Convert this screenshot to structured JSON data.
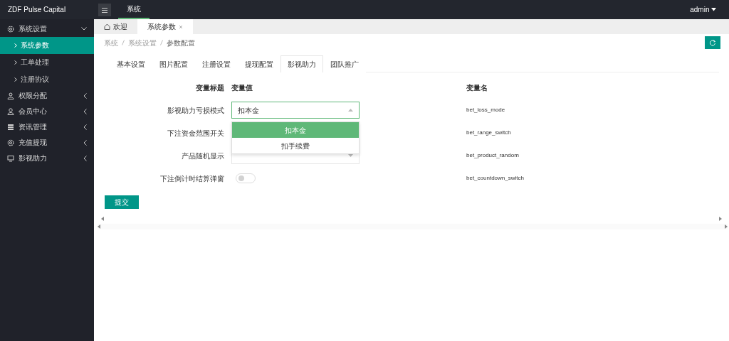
{
  "app": {
    "title": "ZDF Pulse Capital"
  },
  "top_nav": [
    {
      "label": "系统",
      "selected": true
    }
  ],
  "user_menu": {
    "label": "admin"
  },
  "sidebar": {
    "items": [
      {
        "label": "系统设置",
        "expanded": true,
        "children": [
          {
            "label": "系统参数",
            "selected": true
          },
          {
            "label": "工单处理",
            "selected": false
          },
          {
            "label": "注册协议",
            "selected": false
          }
        ]
      },
      {
        "label": "权限分配",
        "expanded": false
      },
      {
        "label": "会员中心",
        "expanded": false
      },
      {
        "label": "资讯管理",
        "expanded": false
      },
      {
        "label": "充值提现",
        "expanded": false
      },
      {
        "label": "影视助力",
        "expanded": false
      }
    ]
  },
  "page_tabs": [
    {
      "label": "欢迎",
      "kind": "home",
      "selected": false
    },
    {
      "label": "系统参数",
      "kind": "closable",
      "selected": true
    }
  ],
  "breadcrumb": [
    "系统",
    "系统设置",
    "参数配置"
  ],
  "settings_tabs": [
    {
      "label": "基本设置",
      "selected": false
    },
    {
      "label": "图片配置",
      "selected": false
    },
    {
      "label": "注册设置",
      "selected": false
    },
    {
      "label": "提现配置",
      "selected": false
    },
    {
      "label": "影视助力",
      "selected": true
    },
    {
      "label": "团队推广",
      "selected": false
    }
  ],
  "form": {
    "columns": [
      "变量标题",
      "变量值",
      "变量名"
    ],
    "rows": [
      {
        "title": "影视助力亏损模式",
        "kind": "select",
        "value": "扣本金",
        "expanded": true,
        "options": [
          {
            "label": "扣本金",
            "selected": true
          },
          {
            "label": "扣手续费",
            "selected": false
          }
        ],
        "name": "bet_loss_mode"
      },
      {
        "title": "下注资金范围开关",
        "kind": "covered",
        "name": "bet_range_switch"
      },
      {
        "title": "产品随机显示",
        "kind": "select",
        "expanded": false,
        "name": "bet_product_random"
      },
      {
        "title": "下注倒计时结算弹窗",
        "kind": "switch",
        "on": false,
        "name": "bet_countdown_switch"
      }
    ],
    "submit": "提交"
  }
}
